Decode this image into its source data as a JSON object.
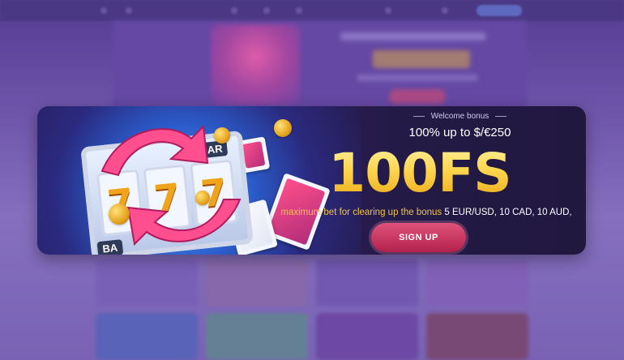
{
  "banner": {
    "eyebrow": "Welcome bonus",
    "subtitle": "100% up to $/€250",
    "headline": "100FS",
    "terms_highlight": "maximum bet for clearing up the bonus",
    "terms_values": "5 EUR/USD, 10 CAD, 10 AUD,",
    "cta_label": "SIGN UP",
    "slot_symbols": [
      "7",
      "7",
      "7"
    ],
    "slot_bar_labels": [
      "BAR",
      "BA"
    ]
  },
  "colors": {
    "accent_gold": "#f0c34a",
    "cta_pink": "#c9305c",
    "banner_bg": "#241a48"
  }
}
